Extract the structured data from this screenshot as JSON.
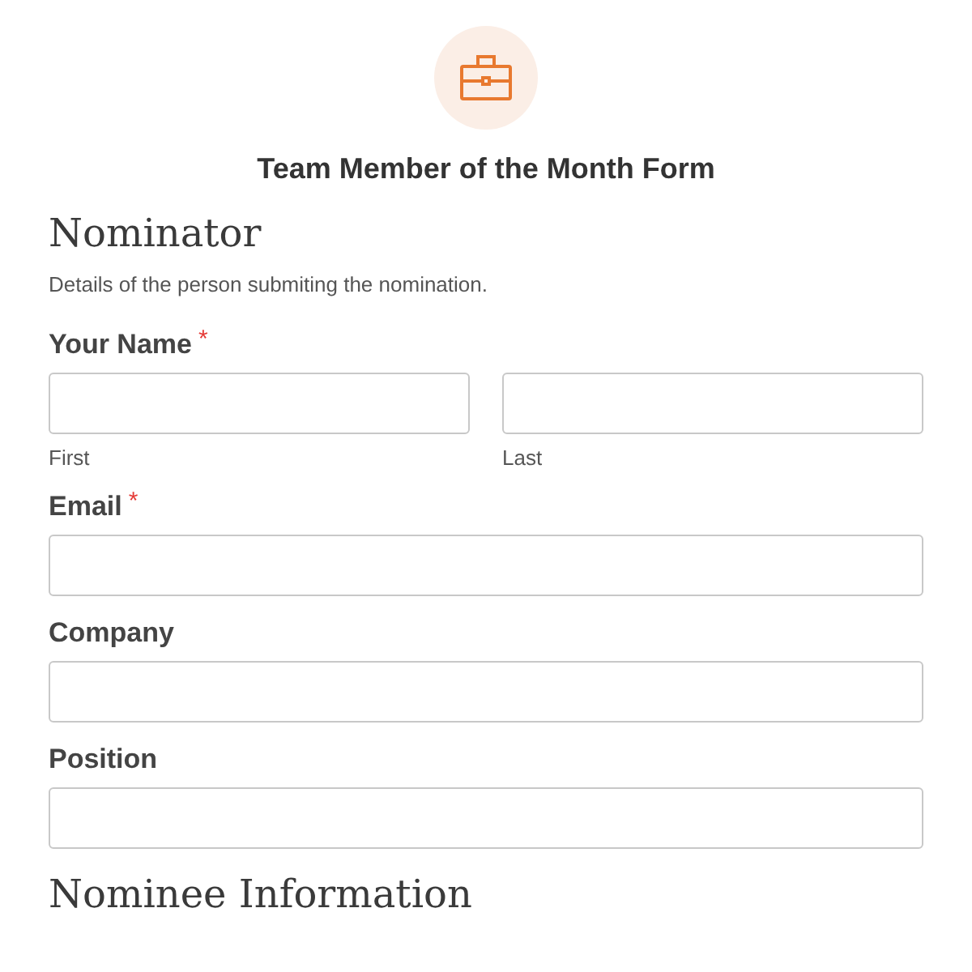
{
  "form": {
    "title": "Team Member of the Month Form"
  },
  "sections": [
    {
      "heading": "Nominator",
      "description": "Details of the person submiting the nomination.",
      "fields": [
        {
          "kind": "name",
          "label": "Your Name",
          "required_mark": "*",
          "sublabels": [
            "First",
            "Last"
          ]
        },
        {
          "kind": "text",
          "label": "Email",
          "required_mark": "*"
        },
        {
          "kind": "text",
          "label": "Company"
        },
        {
          "kind": "text",
          "label": "Position"
        }
      ]
    },
    {
      "heading": "Nominee Information"
    }
  ]
}
